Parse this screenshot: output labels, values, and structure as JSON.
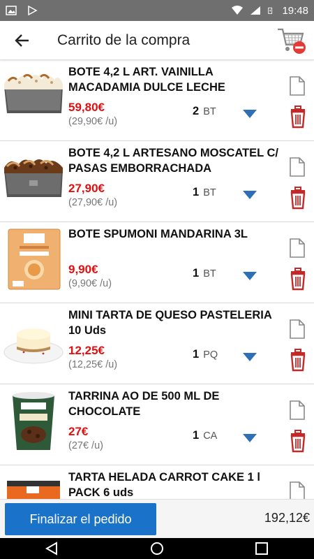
{
  "status_bar": {
    "time": "19:48"
  },
  "app_bar": {
    "title": "Carrito de la compra"
  },
  "items": [
    {
      "name": "BOTE 4,2 L ART. VAINILLA MACADAMIA DULCE LECHE",
      "price": "59,80€",
      "unit_price": "(29,90€ /u)",
      "qty": "2",
      "unit": "BT",
      "thumb": "vanilla-tub"
    },
    {
      "name": "BOTE 4,2 L ARTESANO MOSCATEL C/ PASAS EMBORRACHADA",
      "price": "27,90€",
      "unit_price": "(27,90€ /u)",
      "qty": "1",
      "unit": "BT",
      "thumb": "raisin-tub"
    },
    {
      "name": "BOTE SPUMONI MANDARINA 3L",
      "price": "9,90€",
      "unit_price": "(9,90€ /u)",
      "qty": "1",
      "unit": "BT",
      "thumb": "spumoni-box"
    },
    {
      "name": "MINI TARTA DE QUESO PASTELERIA 10 Uds",
      "price": "12,25€",
      "unit_price": "(12,25€ /u)",
      "qty": "1",
      "unit": "PQ",
      "thumb": "cheesecake"
    },
    {
      "name": "TARRINA AO DE 500 ML DE CHOCOLATE",
      "price": "27€",
      "unit_price": "(27€ /u)",
      "qty": "1",
      "unit": "CA",
      "thumb": "chocolate-tub"
    },
    {
      "name": "TARTA HELADA CARROT CAKE 1 l PACK 6 uds",
      "price": "",
      "unit_price": "",
      "qty": "",
      "unit": "",
      "thumb": "carrot-cake"
    }
  ],
  "footer": {
    "finalize_label": "Finalizar el pedido",
    "total": "192,12€"
  },
  "colors": {
    "price": "#e01010",
    "accent": "#1a73c9",
    "trash": "#c62828",
    "arrow": "#2e6fb5"
  }
}
